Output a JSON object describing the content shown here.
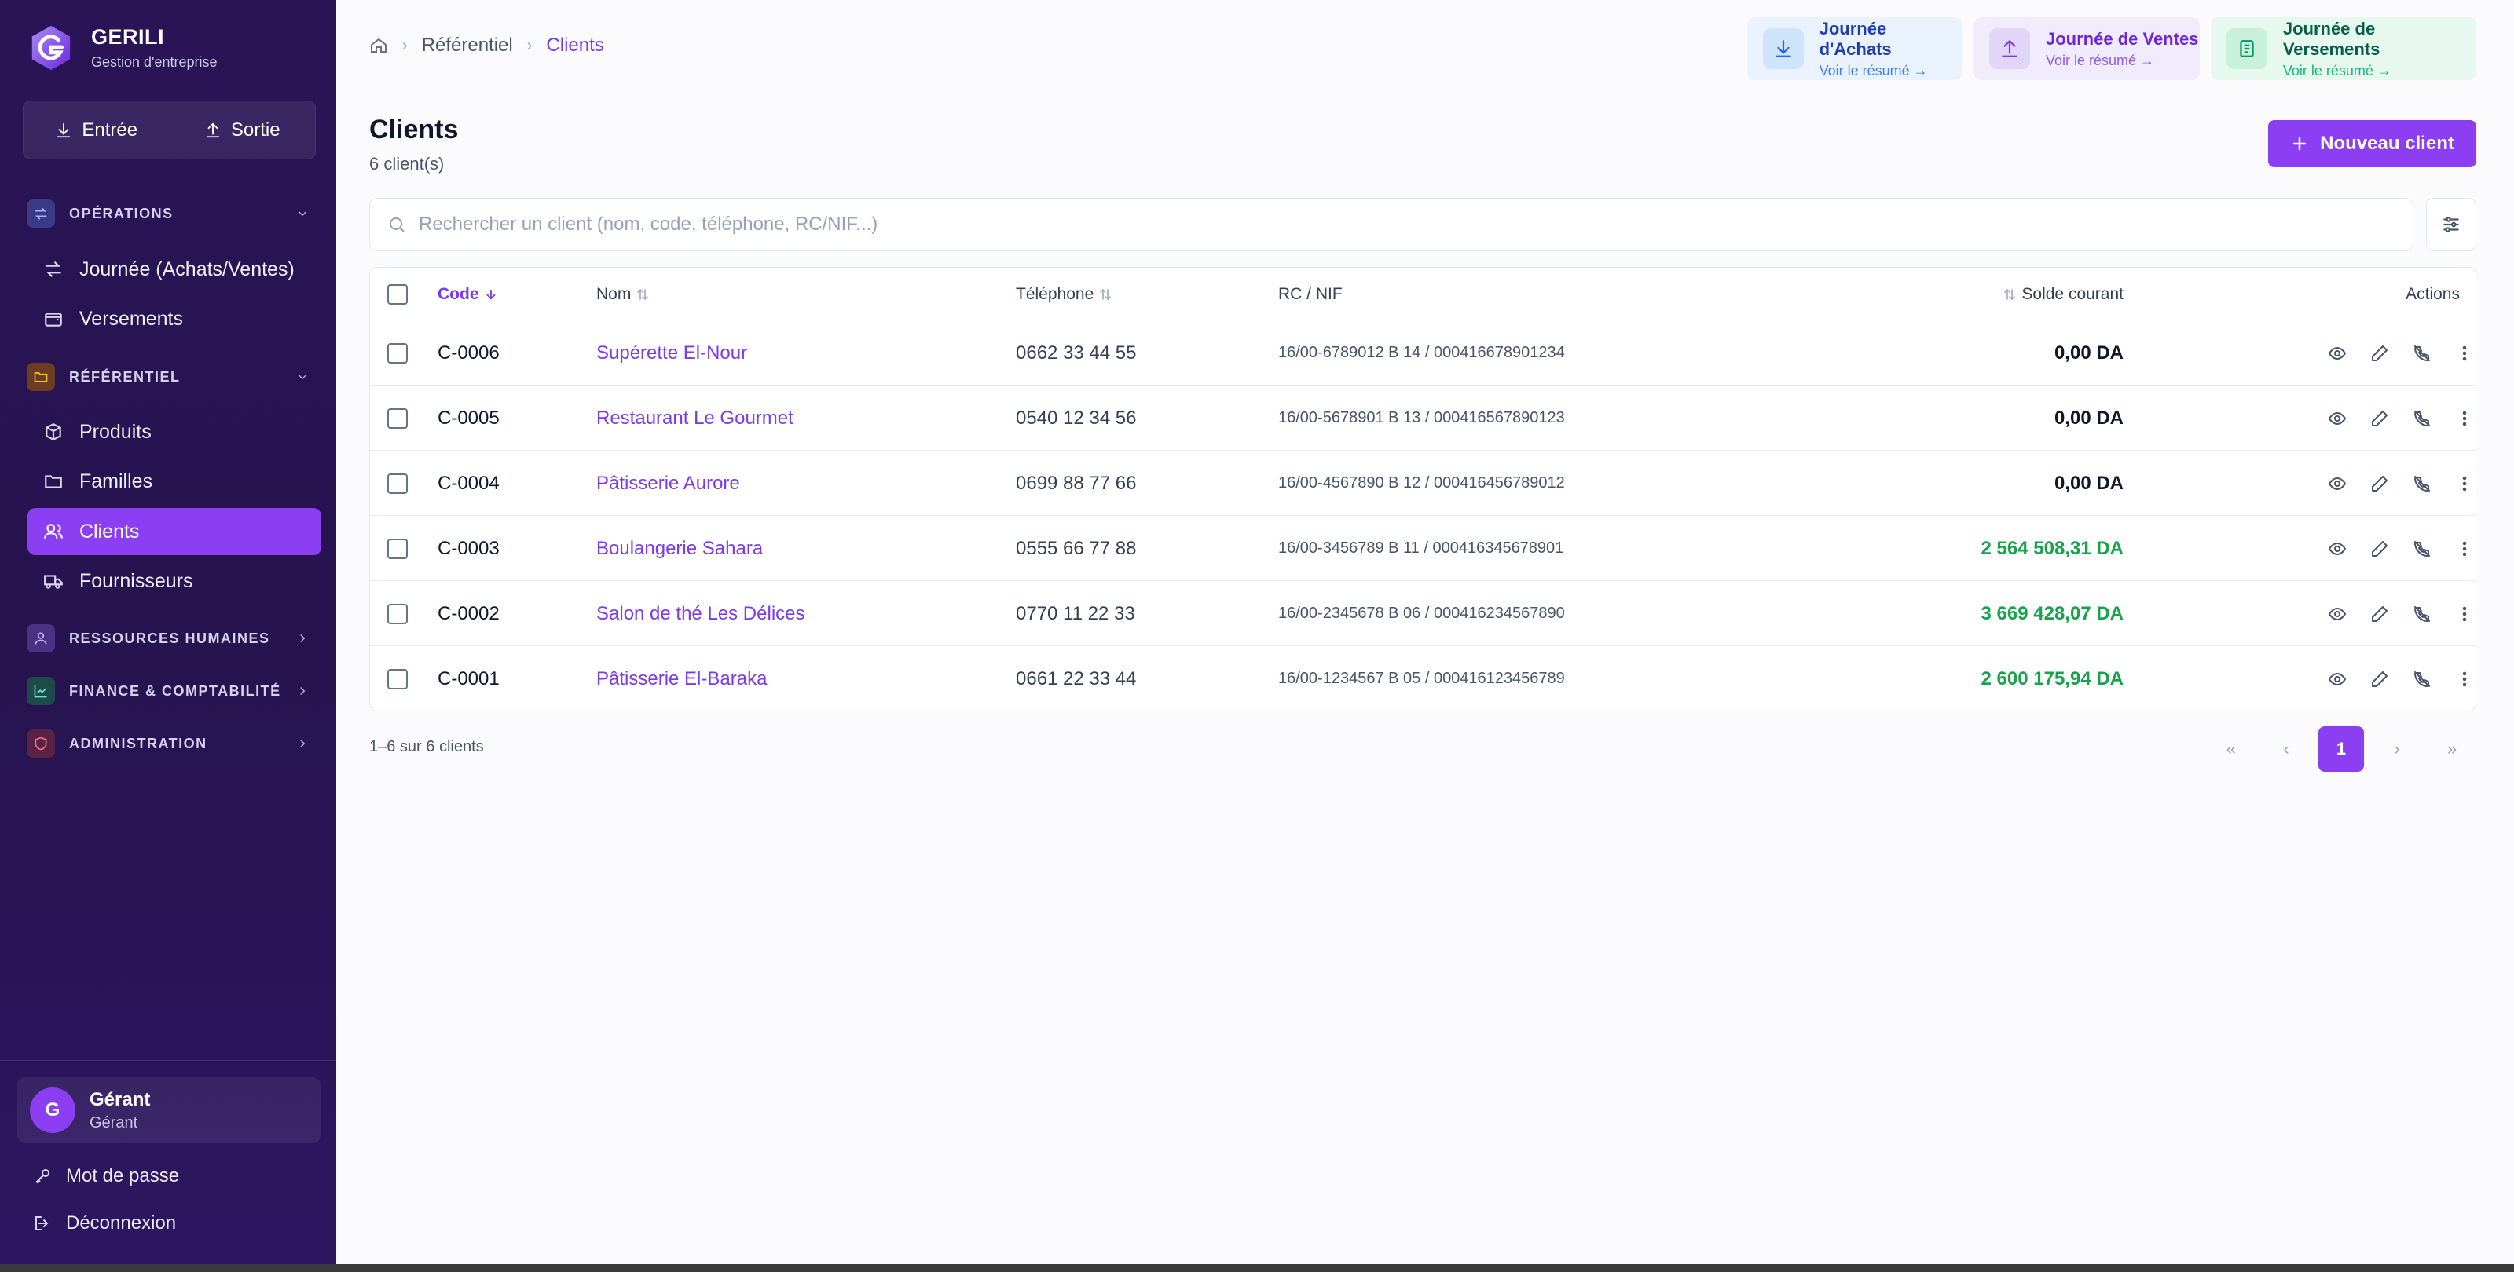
{
  "brand": {
    "name": "GERILI",
    "subtitle": "Gestion d'entreprise"
  },
  "io": {
    "in_label": "Entrée",
    "out_label": "Sortie"
  },
  "nav": {
    "operations": {
      "label": "OPÉRATIONS",
      "items": [
        "Journée (Achats/Ventes)",
        "Versements"
      ]
    },
    "referentiel": {
      "label": "RÉFÉRENTIEL",
      "items": [
        "Produits",
        "Familles",
        "Clients",
        "Fournisseurs"
      ],
      "active": "Clients"
    },
    "rh": {
      "label": "RESSOURCES HUMAINES"
    },
    "finance": {
      "label": "FINANCE & COMPTABILITÉ"
    },
    "admin": {
      "label": "ADMINISTRATION"
    }
  },
  "user": {
    "initial": "G",
    "name": "Gérant",
    "role": "Gérant"
  },
  "footer": {
    "password": "Mot de passe",
    "logout": "Déconnexion"
  },
  "breadcrumb": {
    "level1": "Référentiel",
    "current": "Clients"
  },
  "journals": [
    {
      "title": "Journée d'Achats",
      "sub": "Voir le résumé →",
      "color": "#1e40af",
      "sub_color": "#3b82f6",
      "bg": "#eaf3fd",
      "icon_bg": "#cfe3fb",
      "icon": "download-icon"
    },
    {
      "title": "Journée de Ventes",
      "sub": "Voir le résumé →",
      "color": "#6d28d9",
      "sub_color": "#8b5cf6",
      "bg": "#f1ecfb",
      "icon_bg": "#e2d6f8",
      "icon": "upload-icon"
    },
    {
      "title": "Journée de Versements",
      "sub": "Voir le résumé →",
      "color": "#065f46",
      "sub_color": "#10b981",
      "bg": "#e7f8ef",
      "icon_bg": "#c8f0da",
      "icon": "receipt-icon"
    }
  ],
  "page": {
    "title": "Clients",
    "count": "6 client(s)",
    "new_button": "Nouveau client"
  },
  "search": {
    "placeholder": "Rechercher un client (nom, code, téléphone, RC/NIF...)"
  },
  "table": {
    "headers": {
      "code": "Code",
      "name": "Nom",
      "phone": "Téléphone",
      "rc": "RC / NIF",
      "balance": "Solde courant",
      "actions": "Actions"
    },
    "rows": [
      {
        "code": "C-0006",
        "name": "Supérette El-Nour",
        "phone": "0662 33 44 55",
        "rc": "16/00-6789012 B 14 / 000416678901234",
        "balance": "0,00 DA",
        "positive": false
      },
      {
        "code": "C-0005",
        "name": "Restaurant Le Gourmet",
        "phone": "0540 12 34 56",
        "rc": "16/00-5678901 B 13 / 000416567890123",
        "balance": "0,00 DA",
        "positive": false
      },
      {
        "code": "C-0004",
        "name": "Pâtisserie Aurore",
        "phone": "0699 88 77 66",
        "rc": "16/00-4567890 B 12 / 000416456789012",
        "balance": "0,00 DA",
        "positive": false
      },
      {
        "code": "C-0003",
        "name": "Boulangerie Sahara",
        "phone": "0555 66 77 88",
        "rc": "16/00-3456789 B 11 / 000416345678901",
        "balance": "2 564 508,31 DA",
        "positive": true
      },
      {
        "code": "C-0002",
        "name": "Salon de thé Les Délices",
        "phone": "0770 11 22 33",
        "rc": "16/00-2345678 B 06 / 000416234567890",
        "balance": "3 669 428,07 DA",
        "positive": true
      },
      {
        "code": "C-0001",
        "name": "Pâtisserie El-Baraka",
        "phone": "0661 22 33 44",
        "rc": "16/00-1234567 B 05 / 000416123456789",
        "balance": "2 600 175,94 DA",
        "positive": true
      }
    ]
  },
  "pagination": {
    "info": "1–6 sur 6 clients",
    "first": "«",
    "prev": "‹",
    "current": "1",
    "next": "›",
    "last": "»"
  },
  "colors": {
    "accent": "#8b3ef2",
    "positive": "#16a34a",
    "zero": "#0f172a"
  }
}
